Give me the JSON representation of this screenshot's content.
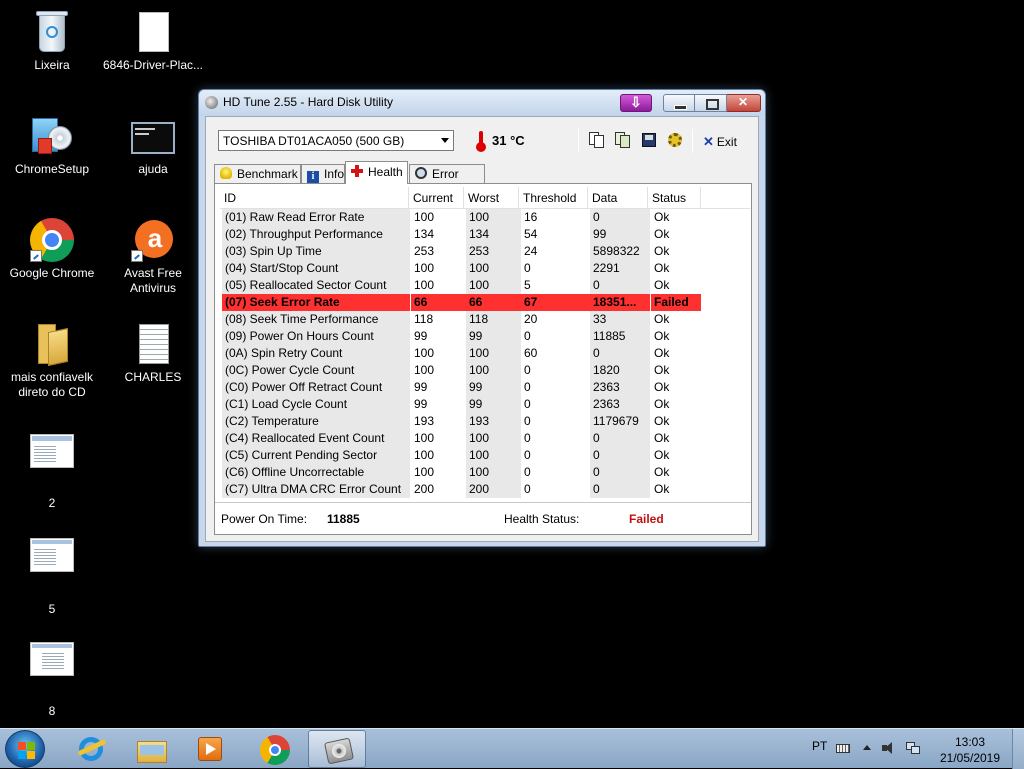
{
  "desktop_icons": [
    {
      "name": "desktop-icon-lixeira",
      "label": "Lixeira"
    },
    {
      "name": "desktop-icon-driver",
      "label": "6846-Driver-Plac..."
    },
    {
      "name": "desktop-icon-chromesetup",
      "label": "ChromeSetup"
    },
    {
      "name": "desktop-icon-ajuda",
      "label": "ajuda"
    },
    {
      "name": "desktop-icon-google-chrome",
      "label": "Google Chrome"
    },
    {
      "name": "desktop-icon-avast",
      "label": "Avast Free\nAntivirus"
    },
    {
      "name": "desktop-icon-mais-confiavel",
      "label": "mais confiavelk\ndireto do CD"
    },
    {
      "name": "desktop-icon-charles",
      "label": "CHARLES"
    },
    {
      "name": "desktop-icon-2",
      "label": "2"
    },
    {
      "name": "desktop-icon-5",
      "label": "5"
    },
    {
      "name": "desktop-icon-8",
      "label": "8"
    }
  ],
  "window": {
    "title": "HD Tune 2.55 - Hard Disk Utility",
    "drive": "TOSHIBA DT01ACA050 (500 GB)",
    "temperature": "31 °C",
    "exit_label": "Exit",
    "tabs": {
      "benchmark": "Benchmark",
      "info": "Info",
      "health": "Health",
      "error_scan": "Error Scan"
    },
    "table": {
      "headers": [
        "ID",
        "Current",
        "Worst",
        "Threshold",
        "Data",
        "Status"
      ],
      "rows": [
        [
          "(01) Raw Read Error Rate",
          "100",
          "100",
          "16",
          "0",
          "Ok"
        ],
        [
          "(02) Throughput Performance",
          "134",
          "134",
          "54",
          "99",
          "Ok"
        ],
        [
          "(03) Spin Up Time",
          "253",
          "253",
          "24",
          "5898322",
          "Ok"
        ],
        [
          "(04) Start/Stop Count",
          "100",
          "100",
          "0",
          "2291",
          "Ok"
        ],
        [
          "(05) Reallocated Sector Count",
          "100",
          "100",
          "5",
          "0",
          "Ok"
        ],
        [
          "(07) Seek Error Rate",
          "66",
          "66",
          "67",
          "18351...",
          "Failed"
        ],
        [
          "(08) Seek Time Performance",
          "118",
          "118",
          "20",
          "33",
          "Ok"
        ],
        [
          "(09) Power On Hours Count",
          "99",
          "99",
          "0",
          "11885",
          "Ok"
        ],
        [
          "(0A) Spin Retry Count",
          "100",
          "100",
          "60",
          "0",
          "Ok"
        ],
        [
          "(0C) Power Cycle Count",
          "100",
          "100",
          "0",
          "1820",
          "Ok"
        ],
        [
          "(C0) Power Off Retract Count",
          "99",
          "99",
          "0",
          "2363",
          "Ok"
        ],
        [
          "(C1) Load Cycle Count",
          "99",
          "99",
          "0",
          "2363",
          "Ok"
        ],
        [
          "(C2) Temperature",
          "193",
          "193",
          "0",
          "1179679",
          "Ok"
        ],
        [
          "(C4) Reallocated Event Count",
          "100",
          "100",
          "0",
          "0",
          "Ok"
        ],
        [
          "(C5) Current Pending Sector",
          "100",
          "100",
          "0",
          "0",
          "Ok"
        ],
        [
          "(C6) Offline Uncorrectable",
          "100",
          "100",
          "0",
          "0",
          "Ok"
        ],
        [
          "(C7) Ultra DMA CRC Error Count",
          "200",
          "200",
          "0",
          "0",
          "Ok"
        ]
      ]
    },
    "summary": {
      "power_on_label": "Power On Time:",
      "power_on_value": "11885",
      "health_label": "Health Status:",
      "health_value": "Failed"
    }
  },
  "taskbar": {
    "language": "PT",
    "time": "13:03",
    "date": "21/05/2019"
  },
  "colors": {
    "failed_row": "#ff3030",
    "failed_text": "#c01010"
  }
}
